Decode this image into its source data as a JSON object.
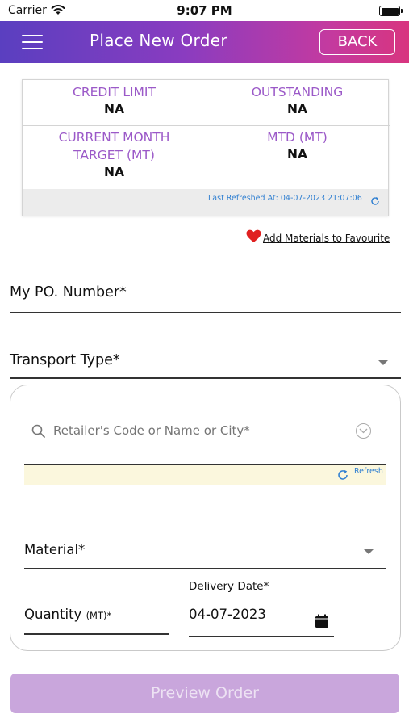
{
  "status_bar": {
    "carrier": "Carrier",
    "time": "9:07 PM"
  },
  "header": {
    "title": "Place New Order",
    "back_label": "BACK",
    "gradient_start": "#5a3fc0",
    "gradient_end": "#d8357f"
  },
  "summary": {
    "credit_limit_label": "CREDIT LIMIT",
    "credit_limit_value": "NA",
    "outstanding_label": "OUTSTANDING",
    "outstanding_value": "NA",
    "target_label_line1": "CURRENT MONTH",
    "target_label_line2": "TARGET (MT)",
    "target_value": "NA",
    "mtd_label": "MTD (MT)",
    "mtd_value": "NA",
    "last_refreshed": "Last Refreshed At: 04-07-2023 21:07:06",
    "label_color": "#9b59c8"
  },
  "favourite": {
    "label": "Add Materials to Favourite",
    "heart_color": "#e02020"
  },
  "form": {
    "po_number_label": "My PO. Number*",
    "transport_type_label": "Transport Type*",
    "retailer_placeholder": "Retailer's Code or Name or City*",
    "refresh_label": "Refresh",
    "material_label": "Material*",
    "quantity_label": "Quantity",
    "quantity_unit": "(MT)*",
    "delivery_date_label": "Delivery Date*",
    "delivery_date_value": "04-07-2023"
  },
  "preview_button": {
    "label": "Preview Order",
    "color": "#c9a6dc"
  }
}
